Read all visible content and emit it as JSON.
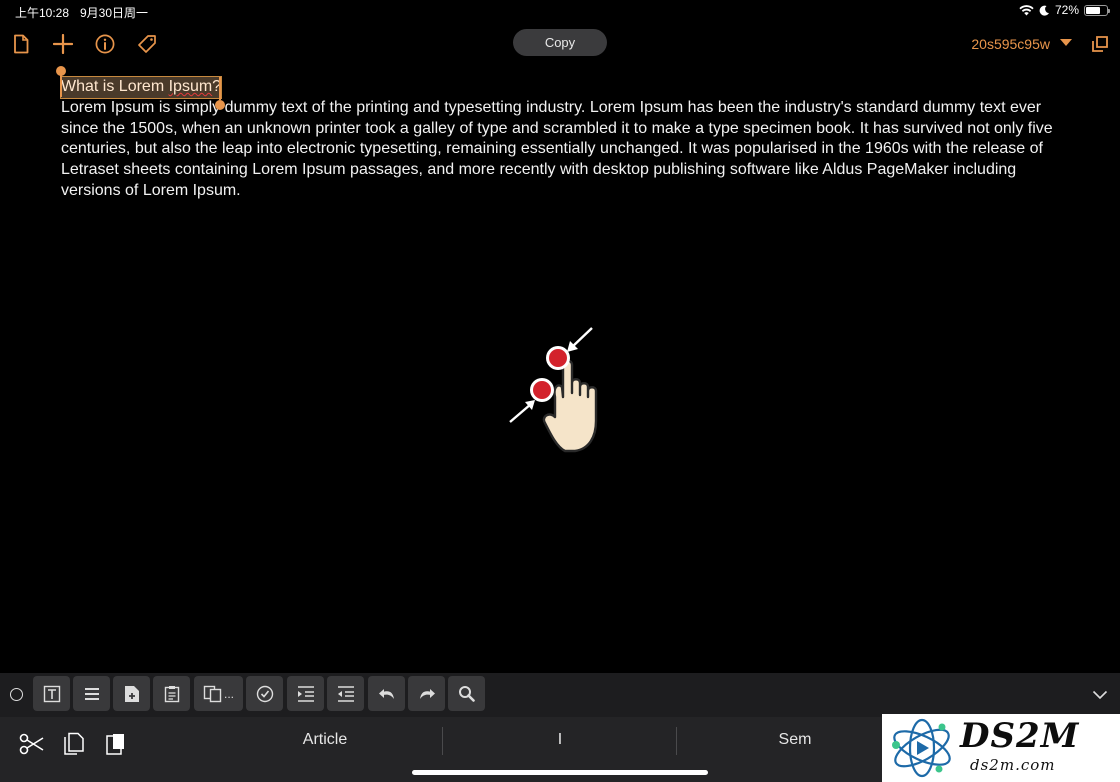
{
  "status_bar": {
    "time": "上午10:28",
    "date": "9月30日周一",
    "battery": "72%",
    "battery_level": 0.72
  },
  "toolbar": {
    "copy_label": "Copy",
    "document_title": "20s595c95w",
    "accent_color": "#e8954b"
  },
  "editor": {
    "heading_before": "What is Lorem ",
    "heading_misspelled": "Ipsum",
    "heading_after": "?",
    "body": "Lorem Ipsum is simply dummy text of the printing and typesetting industry. Lorem Ipsum has been the industry's standard dummy text ever since the 1500s, when an unknown printer took a galley of type and scrambled it to make a type specimen book. It has survived not only five centuries, but also the leap into electronic typesetting, remaining essentially unchanged. It was popularised in the 1960s with the release of Letraset sheets containing Lorem Ipsum passages, and more recently with desktop publishing software like Aldus PageMaker including versions of Lorem Ipsum."
  },
  "format_bar": {
    "buttons": [
      "text-format-icon",
      "list-icon",
      "add-page-icon",
      "clipboard-icon",
      "copy-more-icon",
      "checkbox-icon",
      "indent-icon",
      "outdent-icon",
      "undo-icon",
      "redo-icon",
      "search-icon"
    ],
    "copy_more_ellipsis": "..."
  },
  "keyboard_bar": {
    "suggestions": [
      "Article",
      "I",
      "Sem"
    ]
  },
  "watermark": {
    "logo_text": "DS2M",
    "url_text": "ds2m.com"
  }
}
